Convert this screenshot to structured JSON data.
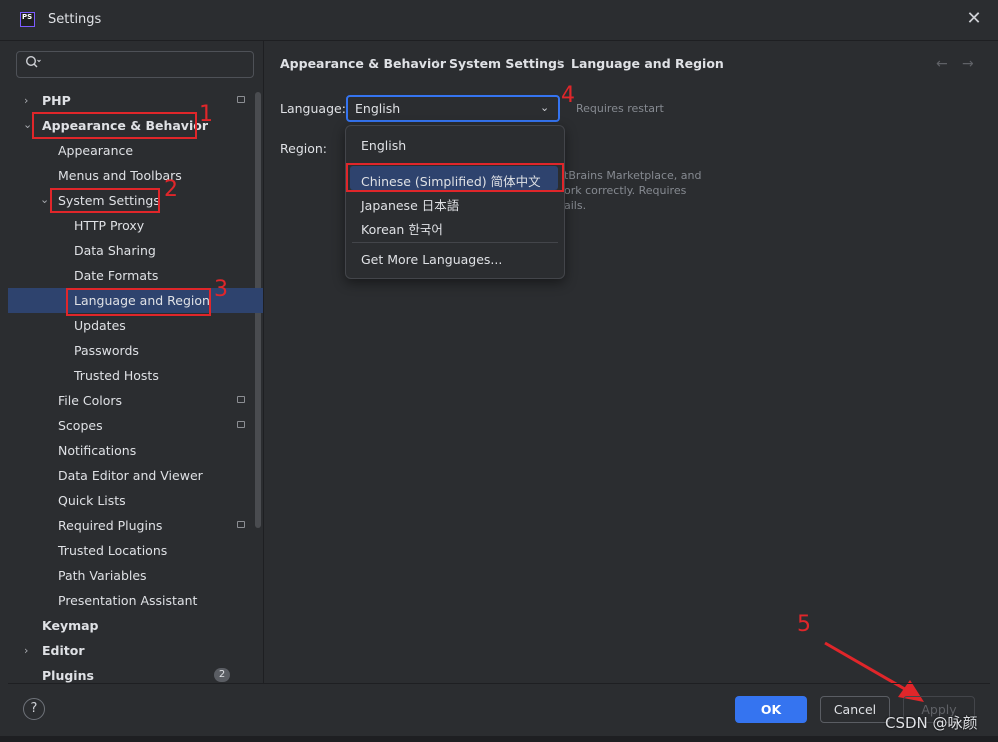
{
  "window": {
    "title": "Settings",
    "app_icon_text": "PS",
    "close_glyph": "✕"
  },
  "search": {
    "placeholder": "",
    "icon": "search-icon"
  },
  "sidebar": {
    "items": [
      {
        "label": "PHP"
      },
      {
        "label": "Appearance & Behavior"
      },
      {
        "label": "Appearance"
      },
      {
        "label": "Menus and Toolbars"
      },
      {
        "label": "System Settings"
      },
      {
        "label": "HTTP Proxy"
      },
      {
        "label": "Data Sharing"
      },
      {
        "label": "Date Formats"
      },
      {
        "label": "Language and Region"
      },
      {
        "label": "Updates"
      },
      {
        "label": "Passwords"
      },
      {
        "label": "Trusted Hosts"
      },
      {
        "label": "File Colors"
      },
      {
        "label": "Scopes"
      },
      {
        "label": "Notifications"
      },
      {
        "label": "Data Editor and Viewer"
      },
      {
        "label": "Quick Lists"
      },
      {
        "label": "Required Plugins"
      },
      {
        "label": "Trusted Locations"
      },
      {
        "label": "Path Variables"
      },
      {
        "label": "Presentation Assistant"
      },
      {
        "label": "Keymap"
      },
      {
        "label": "Editor"
      },
      {
        "label": "Plugins"
      }
    ],
    "plugins_badge": "2",
    "selected": "Language and Region"
  },
  "breadcrumb": [
    "Appearance & Behavior",
    "System Settings",
    "Language and Region"
  ],
  "nav": {
    "back_glyph": "←",
    "forward_glyph": "→"
  },
  "form": {
    "language_label": "Language:",
    "language_value": "English",
    "requires_restart": "Requires restart",
    "region_label": "Region:",
    "hint_lines": [
      "tBrains Marketplace, and",
      "ork correctly. Requires",
      "ails."
    ]
  },
  "dropdown": {
    "options": [
      "English",
      "Chinese (Simplified) 简体中文",
      "Japanese 日本語",
      "Korean 한국어"
    ],
    "more": "Get More Languages...",
    "highlighted": "Chinese (Simplified) 简体中文"
  },
  "annotations": {
    "markers": [
      "1",
      "2",
      "3",
      "4",
      "5"
    ],
    "color": "#e0262a"
  },
  "buttons": {
    "help": "?",
    "ok": "OK",
    "cancel": "Cancel",
    "apply": "Apply"
  },
  "watermark": "CSDN @咏颜",
  "colors": {
    "accent": "#3574f0",
    "selection": "#2e436e",
    "background": "#2b2d30",
    "annotation_red": "#e0262a"
  }
}
